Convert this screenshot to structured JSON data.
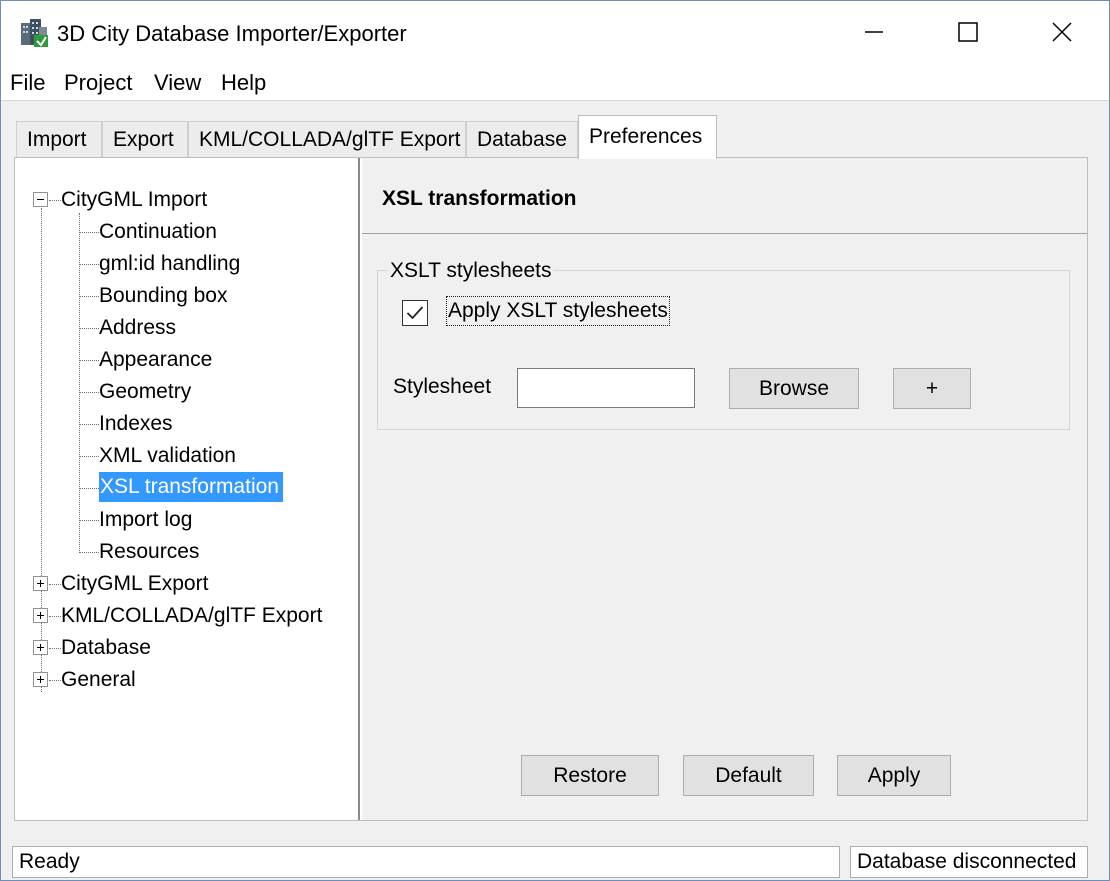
{
  "window": {
    "title": "3D City Database Importer/Exporter",
    "icon": "city-database-app-icon"
  },
  "menubar": {
    "items": [
      {
        "label": "File"
      },
      {
        "label": "Project"
      },
      {
        "label": "View"
      },
      {
        "label": "Help"
      }
    ]
  },
  "tabs": [
    {
      "label": "Import",
      "active": false
    },
    {
      "label": "Export",
      "active": false
    },
    {
      "label": "KML/COLLADA/glTF Export",
      "active": false
    },
    {
      "label": "Database",
      "active": false
    },
    {
      "label": "Preferences",
      "active": true
    }
  ],
  "tree": {
    "root_nodes": [
      {
        "label": "CityGML Import",
        "expanded": true
      },
      {
        "label": "CityGML Export",
        "expanded": false
      },
      {
        "label": "KML/COLLADA/glTF Export",
        "expanded": false
      },
      {
        "label": "Database",
        "expanded": false
      },
      {
        "label": "General",
        "expanded": false
      }
    ],
    "import_children": [
      {
        "label": "Continuation"
      },
      {
        "label": "gml:id handling"
      },
      {
        "label": "Bounding box"
      },
      {
        "label": "Address"
      },
      {
        "label": "Appearance"
      },
      {
        "label": "Geometry"
      },
      {
        "label": "Indexes"
      },
      {
        "label": "XML validation"
      },
      {
        "label": "XSL transformation",
        "selected": true
      },
      {
        "label": "Import log"
      },
      {
        "label": "Resources"
      }
    ]
  },
  "panel": {
    "title": "XSL transformation",
    "group_title": "XSLT stylesheets",
    "apply_checkbox": {
      "label": "Apply XSLT stylesheets",
      "checked": true
    },
    "stylesheet": {
      "label": "Stylesheet",
      "value": ""
    },
    "browse_label": "Browse",
    "add_label": "+",
    "restore_label": "Restore",
    "default_label": "Default",
    "apply_label": "Apply"
  },
  "status": {
    "left": "Ready",
    "right": "Database disconnected"
  },
  "colors": {
    "selection": "#3399ff",
    "window_bg": "#f0f0f0"
  }
}
